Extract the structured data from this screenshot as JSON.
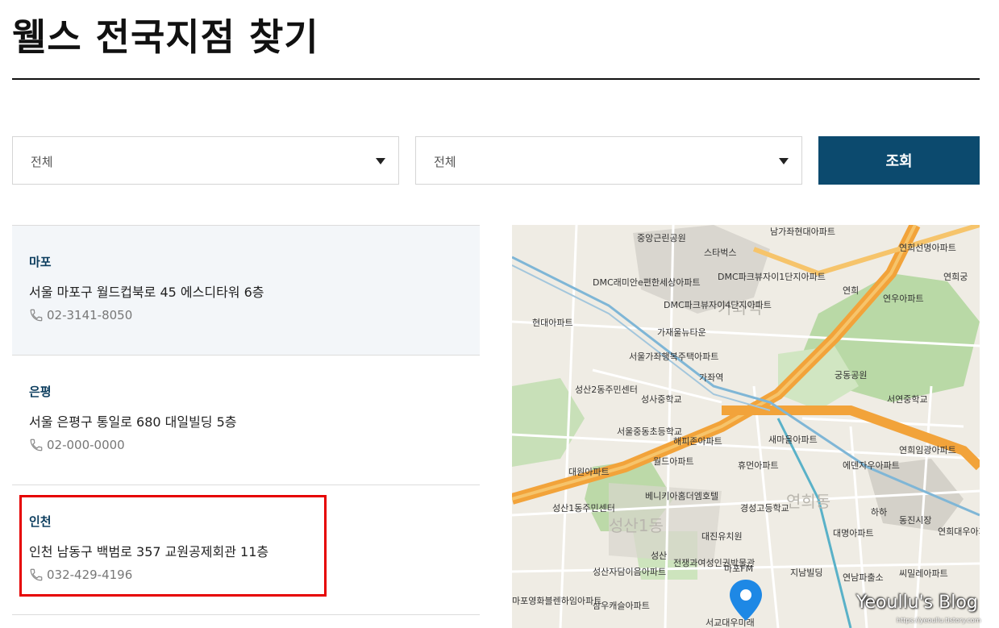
{
  "page": {
    "title": "웰스 전국지점 찾기"
  },
  "filters": {
    "region": {
      "value": "전체"
    },
    "district": {
      "value": "전체"
    },
    "search_label": "조회"
  },
  "branches": [
    {
      "name": "마포",
      "address": "서울 마포구 월드컵북로 45 에스디타워 6층",
      "phone": "02-3141-8050"
    },
    {
      "name": "은평",
      "address": "서울 은평구 통일로 680 대일빌딩 5층",
      "phone": "02-000-0000"
    },
    {
      "name": "인천",
      "address": "인천 남동구 백범로 357 교원공제회관 11층",
      "phone": "032-429-4196"
    }
  ],
  "map": {
    "labels": [
      "중앙근린공원",
      "남가좌현대아파트",
      "스타벅스",
      "연희선명아파트",
      "연희궁",
      "DMC래미안e편한세상아파트",
      "DMC파크뷰자이1단지아파트",
      "연희",
      "연우아파트",
      "DMC파크뷰자이4단지아파트",
      "현대아파트",
      "가재울뉴타운",
      "서울가좌행복주택아파트",
      "가좌역",
      "궁동공원",
      "성산2동주민센터",
      "성사중학교",
      "서연중학교",
      "서울중동초등학교",
      "해피존아파트",
      "새마을아파트",
      "연희임광아파트",
      "대원아파트",
      "월드아파트",
      "휴먼아파트",
      "에덴자우아파트",
      "성산1동주민센터",
      "베니키아홈더엠호텔",
      "경성고등학교",
      "하하",
      "동진시장",
      "성산1동",
      "대진유치원",
      "대명아파트",
      "연희대우아파트",
      "성산",
      "전쟁과여성인권박물관",
      "마포FM",
      "지남빌딩",
      "연남파출소",
      "씨밀레아파트",
      "성산자담이음아파트",
      "마포영화블렌하임아파트",
      "삼우캐슬아파트",
      "서교대우미래"
    ],
    "big_labels": [
      "가좌역",
      "성산1동",
      "연희동"
    ]
  },
  "watermark": {
    "text": "Yeoullu's Blog",
    "url": "https://yeoullu.tistory.com"
  },
  "colors": {
    "accent": "#0c4a6e",
    "highlight": "#e60000",
    "active_bg": "#f3f6f9",
    "branch_name": "#0c3d5e"
  }
}
